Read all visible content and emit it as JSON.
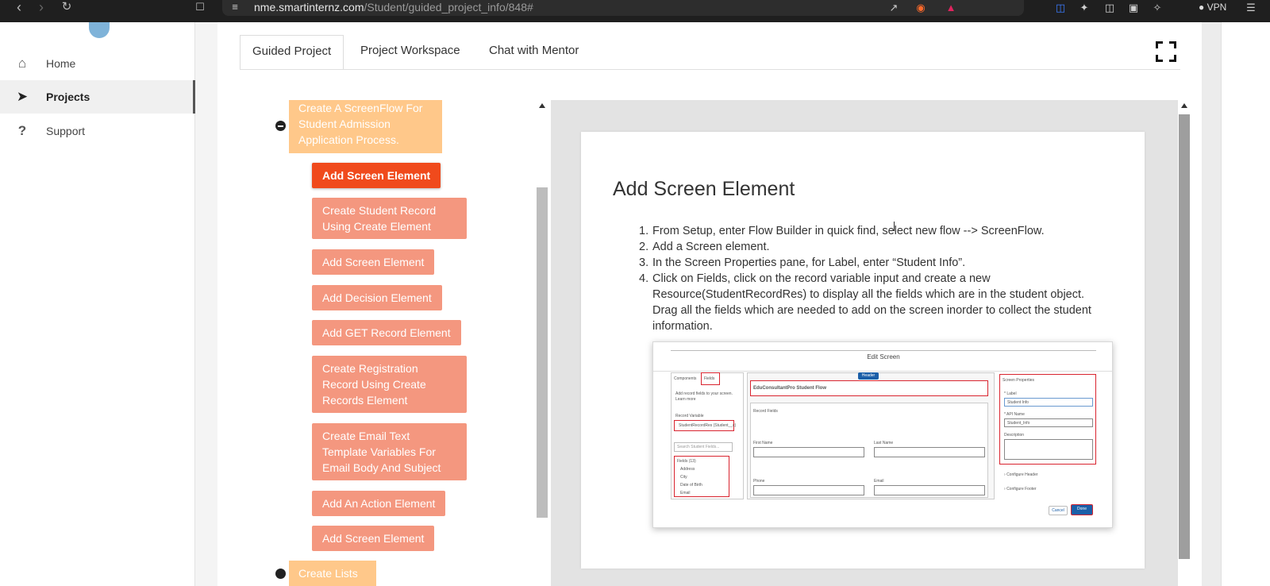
{
  "browser": {
    "url_host": "nme.smartinternz.com",
    "url_path": "/Student/guided_project_info/848#",
    "vpn_label": "VPN",
    "icons": [
      "back-icon",
      "forward-icon",
      "reload-icon",
      "bookmark-icon",
      "site-settings-icon",
      "share-icon",
      "brave-shield-icon",
      "rewards-icon",
      "bitwarden-icon",
      "extensions-icon",
      "sidebar-icon",
      "wallet-icon",
      "leo-icon",
      "menu-icon"
    ]
  },
  "sidebar": {
    "items": [
      {
        "label": "Home",
        "icon": "home-icon"
      },
      {
        "label": "Projects",
        "icon": "paper-plane-icon"
      },
      {
        "label": "Support",
        "icon": "question-icon"
      }
    ]
  },
  "tabs": [
    {
      "label": "Guided Project"
    },
    {
      "label": "Project Workspace"
    },
    {
      "label": "Chat with Mentor"
    }
  ],
  "tree": {
    "parent": "Create A ScreenFlow For Student Admission Application Process.",
    "parent_next": "Create Lists",
    "tasks": [
      {
        "label": "Add Screen Element"
      },
      {
        "label": "Create Student Record Using Create Element"
      },
      {
        "label": "Add Screen Element"
      },
      {
        "label": "Add Decision Element"
      },
      {
        "label": "Add GET Record Element"
      },
      {
        "label": "Create Registration Record Using Create Records Element"
      },
      {
        "label": "Create Email Text Template Variables For Email Body And Subject"
      },
      {
        "label": "Add An Action Element"
      },
      {
        "label": "Add Screen Element"
      }
    ]
  },
  "doc": {
    "title": "Add Screen Element",
    "steps": [
      {
        "num": "1.",
        "text": "From Setup, enter Flow Builder in quick find, select new flow --> ScreenFlow."
      },
      {
        "num": "2.",
        "text": "Add a Screen element."
      },
      {
        "num": "3.",
        "text": "In the Screen Properties pane, for Label, enter “Student Info”."
      },
      {
        "num": "4.",
        "text": "Click on Fields, click on the record variable input and create a new Resource(StudentRecordRes) to display all the fields which are in the  student object. Drag all the fields which are needed to add on the screen inorder to collect the student information."
      }
    ]
  },
  "screenshot": {
    "title": "Edit Screen",
    "tab_components": "Components",
    "tab_fields": "Fields",
    "hint": "Add record fields to your screen. Learn more",
    "record_variable_label": "Record Variable",
    "record_variable_value": "StudentRecordRes (Student__c)",
    "search_placeholder": "Search Student Fields...",
    "field_list": [
      "Fields (13)",
      "Address",
      "City",
      "Date of Birth",
      "Email"
    ],
    "header_badge": "Header",
    "flow_title": "EduConsultantPro Student Flow",
    "section_label": "Record Fields",
    "first_name": "First Name",
    "last_name": "Last Name",
    "phone": "Phone",
    "email": "Email",
    "props_title": "Screen Properties",
    "label_caption": "* Label",
    "label_value": "Student Info",
    "api_caption": "* API Name",
    "api_value": "Student_Info",
    "description_caption": "Description",
    "configure_header": "Configure Header",
    "configure_footer": "Configure Footer",
    "cancel": "Cancel",
    "done": "Done"
  }
}
